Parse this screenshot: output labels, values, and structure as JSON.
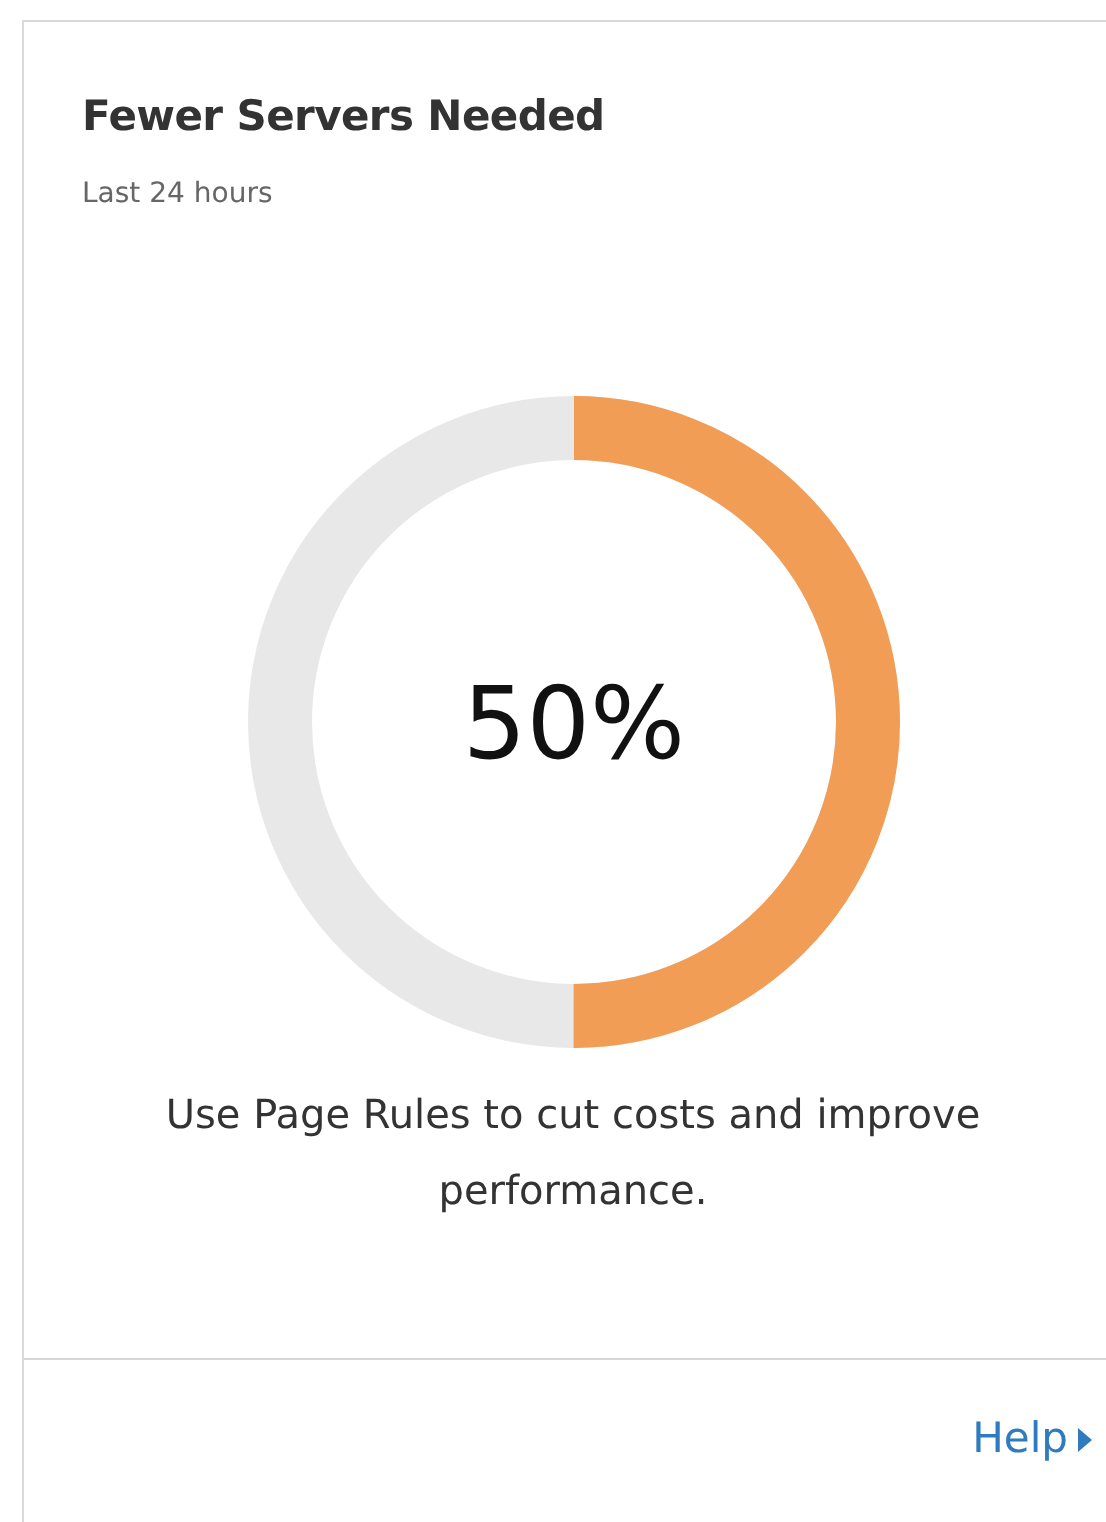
{
  "card": {
    "title": "Fewer Servers Needed",
    "subtitle": "Last 24 hours",
    "gauge": {
      "level": 0.5,
      "reading": "50%"
    },
    "message": "Use Page Rules to cut costs and improve performance.",
    "footer_link": "Help"
  }
}
